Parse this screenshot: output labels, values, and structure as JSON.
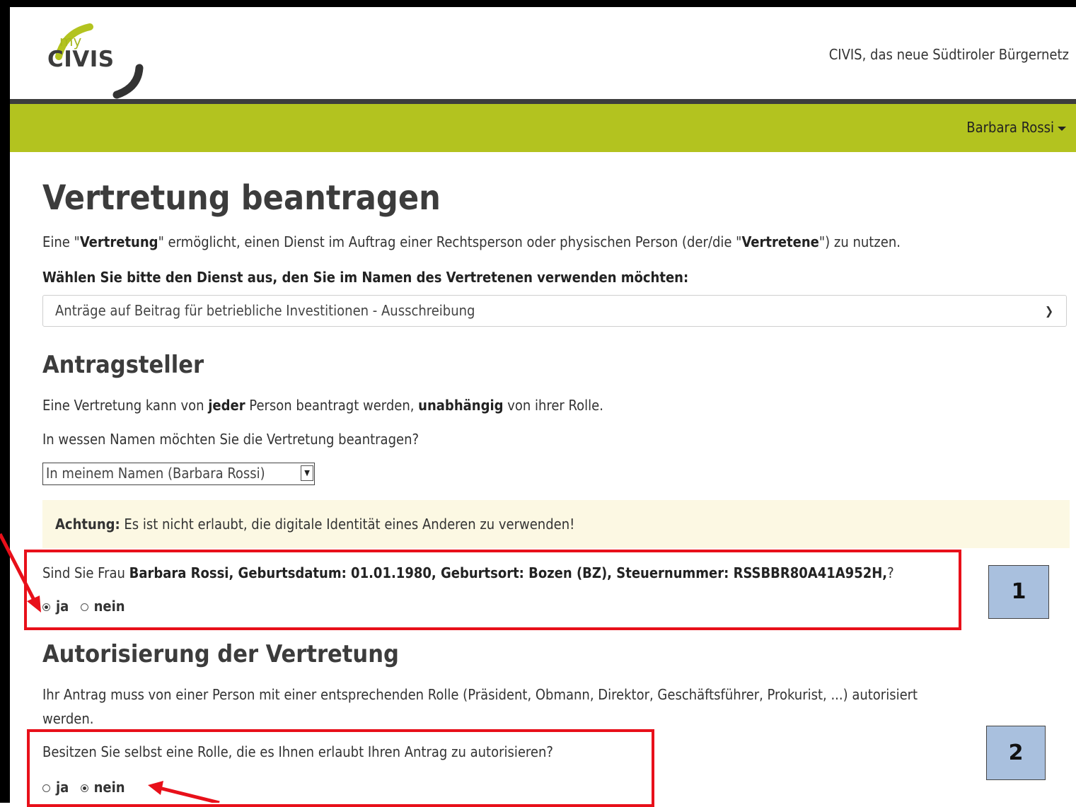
{
  "header": {
    "logo_my": "my",
    "logo_civis": "CIVIS",
    "tagline": "CIVIS, das neue Südtiroler Bürgernetz",
    "user_name": "Barbara Rossi"
  },
  "colors": {
    "brand_green": "#b3c31f",
    "dark_bar": "#3d3d3d",
    "warning_bg": "#fcf8e3",
    "annotation_red": "#e8101a",
    "annotation_box": "#a9c0de"
  },
  "page": {
    "title": "Vertretung beantragen",
    "intro": {
      "t1": "Eine \"",
      "b1": "Vertretung",
      "t2": "\" ermöglicht, einen Dienst im Auftrag einer Rechtsperson oder physischen Person (der/die \"",
      "b2": "Vertretene",
      "t3": "\") zu nutzen."
    },
    "service_prompt": "Wählen Sie bitte den Dienst aus, den Sie im Namen des Vertretenen verwenden möchten:",
    "service_select_value": "Anträge auf Beitrag für betriebliche Investitionen - Ausschreibung"
  },
  "antragsteller": {
    "heading": "Antragsteller",
    "line1": {
      "t1": "Eine Vertretung kann von ",
      "b1": "jeder",
      "t2": " Person beantragt werden, ",
      "b2": "unabhängig",
      "t3": " von ihrer Rolle."
    },
    "question": "In wessen Namen möchten Sie die Vertretung beantragen?",
    "name_select_value": "In meinem Namen (Barbara Rossi)",
    "warning": {
      "label": "Achtung:",
      "text": " Es ist nicht erlaubt, die digitale Identität eines Anderen zu verwenden!"
    },
    "identity_question": {
      "t1": "Sind Sie Frau ",
      "b1": "Barbara Rossi, Geburtsdatum: 01.01.1980, Geburtsort: Bozen (BZ), Steuernummer: RSSBBR80A41A952H,",
      "t2": "?"
    },
    "identity_options": {
      "yes": "ja",
      "no": "nein",
      "selected": "ja"
    }
  },
  "autorisierung": {
    "heading": "Autorisierung der Vertretung",
    "text_line1": "Ihr Antrag muss von einer Person mit einer entsprechenden Rolle (Präsident, Obmann, Direktor, Geschäftsführer, Prokurist, ...) autorisiert",
    "text_line2": "werden.",
    "role_question": "Besitzen Sie selbst eine Rolle, die es Ihnen erlaubt Ihren Antrag zu autorisieren?",
    "role_options": {
      "yes": "ja",
      "no": "nein",
      "selected": "nein"
    }
  },
  "annotations": {
    "box1_label": "1",
    "box2_label": "2"
  }
}
